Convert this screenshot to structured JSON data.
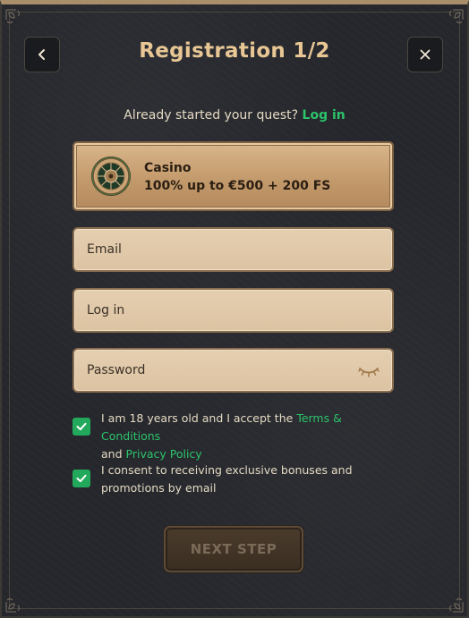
{
  "header": {
    "title": "Registration 1/2",
    "back_icon": "chevron-left-icon",
    "close_icon": "close-icon"
  },
  "quest": {
    "text": "Already started your quest?",
    "login_link": "Log in"
  },
  "bonus": {
    "icon": "roulette-wheel-icon",
    "name": "Casino",
    "description": "100% up to €500 + 200 FS"
  },
  "form": {
    "email_placeholder": "Email",
    "login_placeholder": "Log in",
    "password_placeholder": "Password",
    "password_toggle_icon": "eye-closed-icon"
  },
  "consents": [
    {
      "checked": true,
      "text_before": "I am 18 years old and I accept the",
      "link1": "Terms & Conditions",
      "text_middle": "and",
      "link2": "Privacy Policy"
    },
    {
      "checked": true,
      "text": "I consent to receiving exclusive bonuses and promotions by email"
    }
  ],
  "actions": {
    "next_label": "NEXT STEP"
  },
  "colors": {
    "accent_green": "#2cc36b",
    "checkbox_green": "#22a95c",
    "title_gold": "#e8c795",
    "background": "#25272c"
  }
}
